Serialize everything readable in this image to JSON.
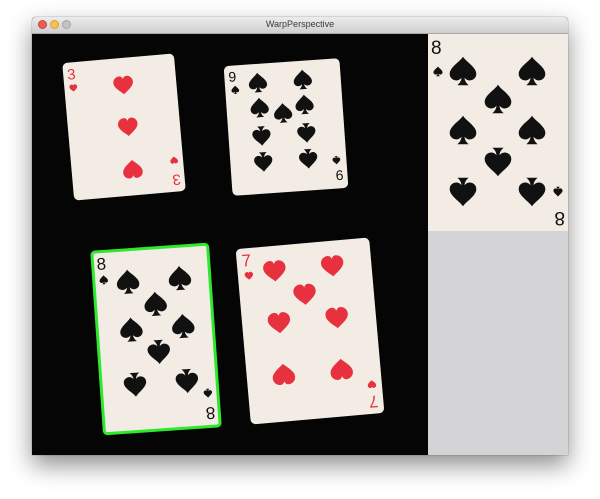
{
  "window": {
    "title": "WarpPerspective"
  },
  "colors": {
    "red_suit": "#e8313e",
    "black_suit": "#111111",
    "card_face": "#f3ece4",
    "selection": "#2ee82e"
  },
  "cards": [
    {
      "rank": "3",
      "suit": "hearts"
    },
    {
      "rank": "9",
      "suit": "spades"
    },
    {
      "rank": "8",
      "suit": "spades",
      "selected": true
    },
    {
      "rank": "7",
      "suit": "hearts"
    }
  ],
  "warped_card": {
    "rank": "8",
    "suit": "spades"
  }
}
